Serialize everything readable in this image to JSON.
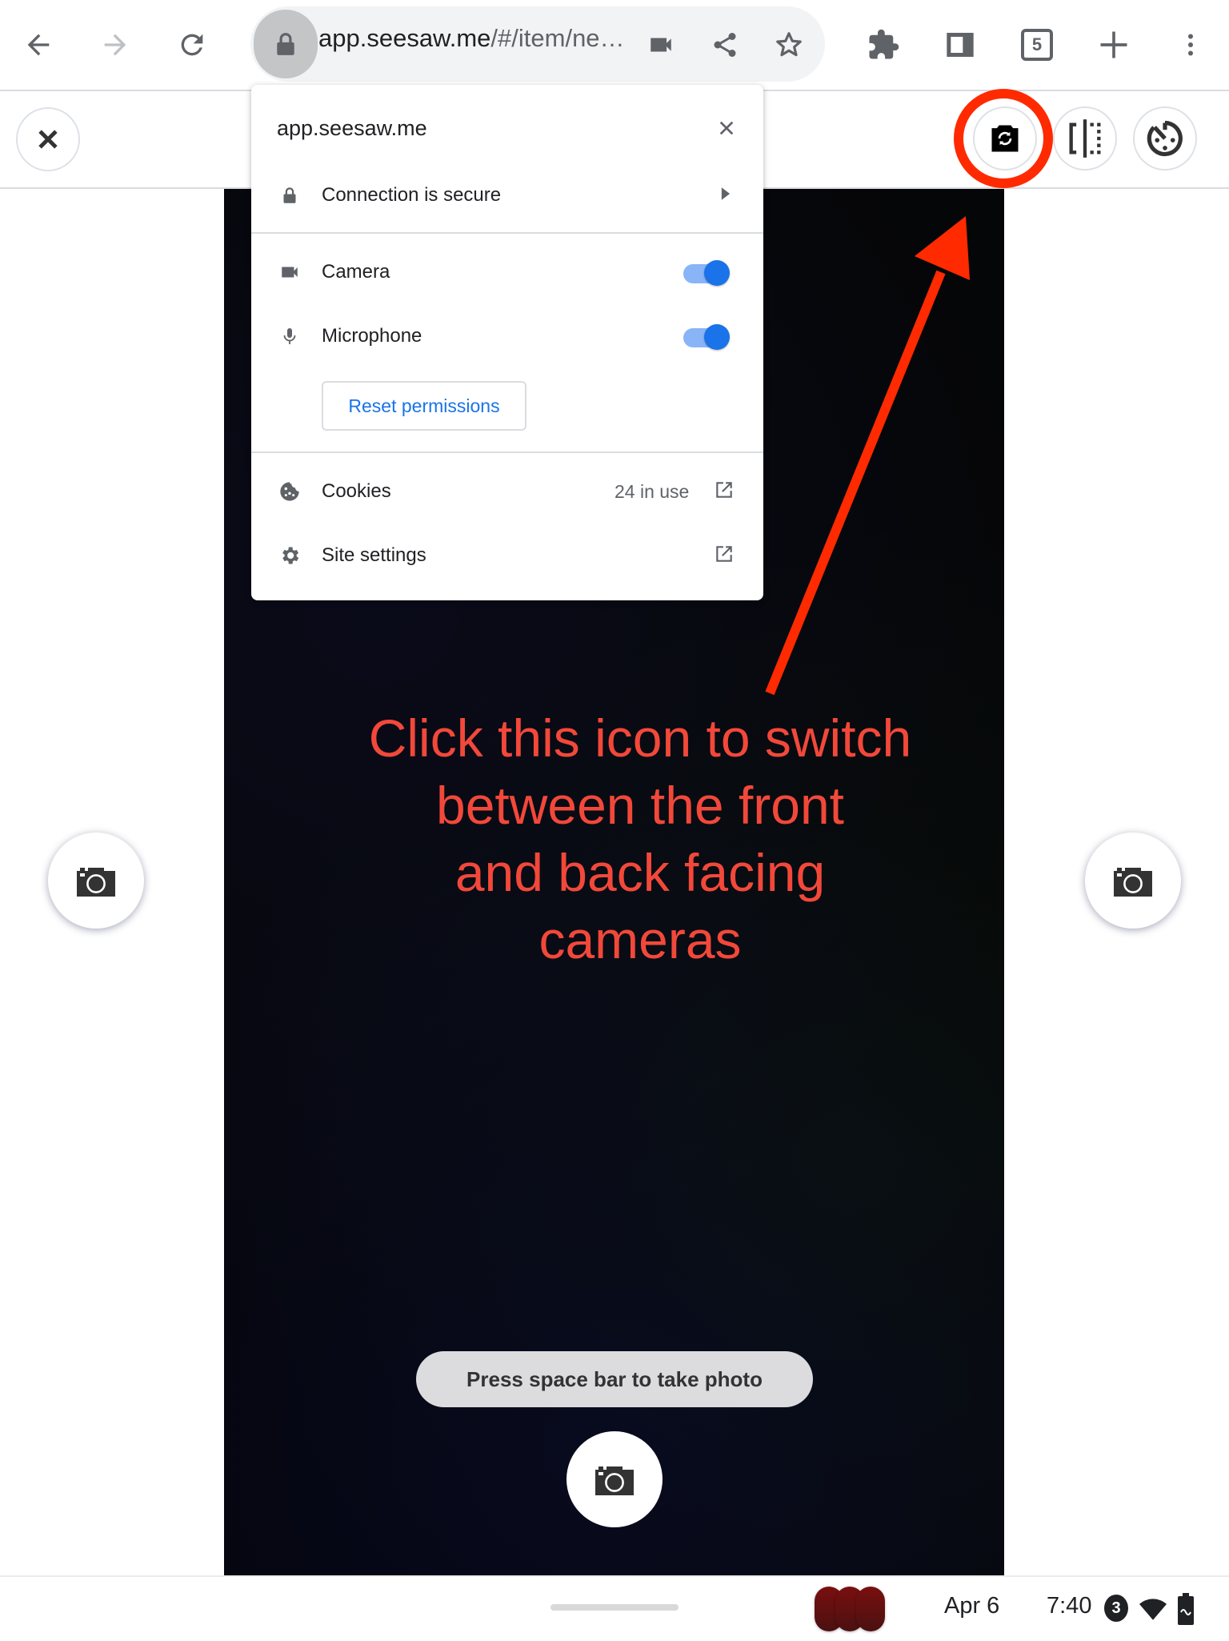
{
  "browser": {
    "url_host": "app.seesaw.me",
    "url_path": "/#/item/ne…",
    "tab_count": "5",
    "icons": [
      "back-icon",
      "forward-icon",
      "reload-icon",
      "lock-icon",
      "camera-in-use-icon",
      "share-icon",
      "bookmark-star-icon",
      "extensions-icon",
      "side-panel-icon",
      "tab-count-icon",
      "new-tab-icon",
      "menu-icon"
    ]
  },
  "site_info_popup": {
    "title": "app.seesaw.me",
    "connection_label": "Connection is secure",
    "permissions": [
      {
        "label": "Camera",
        "icon": "videocam-icon",
        "enabled": true
      },
      {
        "label": "Microphone",
        "icon": "mic-icon",
        "enabled": true
      }
    ],
    "reset_label": "Reset permissions",
    "cookies_label": "Cookies",
    "cookies_count": "24 in use",
    "site_settings_label": "Site settings"
  },
  "app_header": {
    "close_icon": "close-icon",
    "actions": [
      "flip-camera-icon",
      "mirror-icon",
      "timer-icon"
    ]
  },
  "camera": {
    "hint": "Press space bar to take photo"
  },
  "annotation": {
    "lines": [
      "Click this icon to switch",
      "between the front",
      "and back facing",
      "cameras"
    ],
    "color": "#f2483a"
  },
  "shelf": {
    "date": "Apr 6",
    "time": "7:40",
    "notification_count": "3"
  }
}
